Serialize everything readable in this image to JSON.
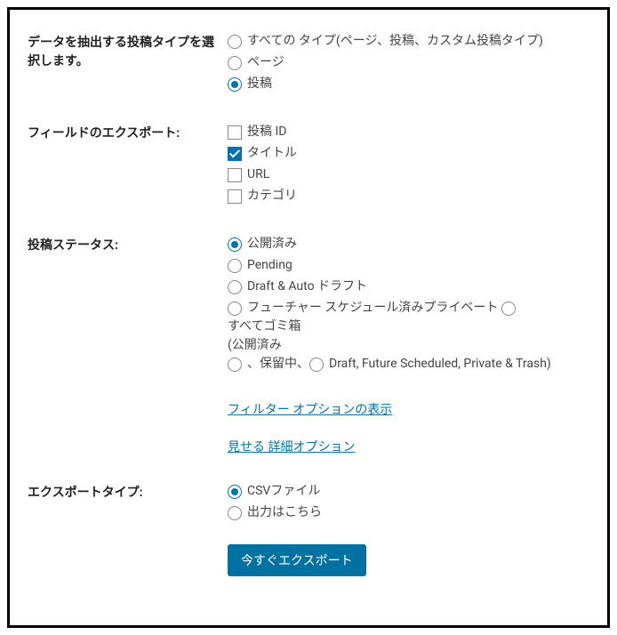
{
  "postType": {
    "label": "データを抽出する投稿タイプを選択します。",
    "options": {
      "all": "すべての タイプ(ページ、投稿、カスタム投稿タイプ)",
      "page": "ページ",
      "post": "投稿"
    }
  },
  "fields": {
    "label": "フィールドのエクスポート:",
    "options": {
      "postId": "投稿 ID",
      "title": "タイトル",
      "url": "URL",
      "category": "カテゴリ"
    }
  },
  "status": {
    "label": "投稿ステータス:",
    "options": {
      "published": "公開済み",
      "pending": "Pending",
      "draft": "Draft & Auto ドラフト",
      "future": "フューチャー スケジュール済みプライベート",
      "trash": "すべてゴミ箱"
    },
    "noteOpen": "(公開済み",
    "notePending": "、保留中、",
    "noteRest": "Draft, Future Scheduled, Private & Trash)"
  },
  "links": {
    "filter": "フィルター オプションの表示",
    "advancedShow": "見せる",
    "advancedRest": "詳細オプション"
  },
  "exportType": {
    "label": "エクスポートタイプ:",
    "options": {
      "csv": "CSVファイル",
      "output": "出力はこちら"
    }
  },
  "button": {
    "export": "今すぐエクスポート"
  }
}
